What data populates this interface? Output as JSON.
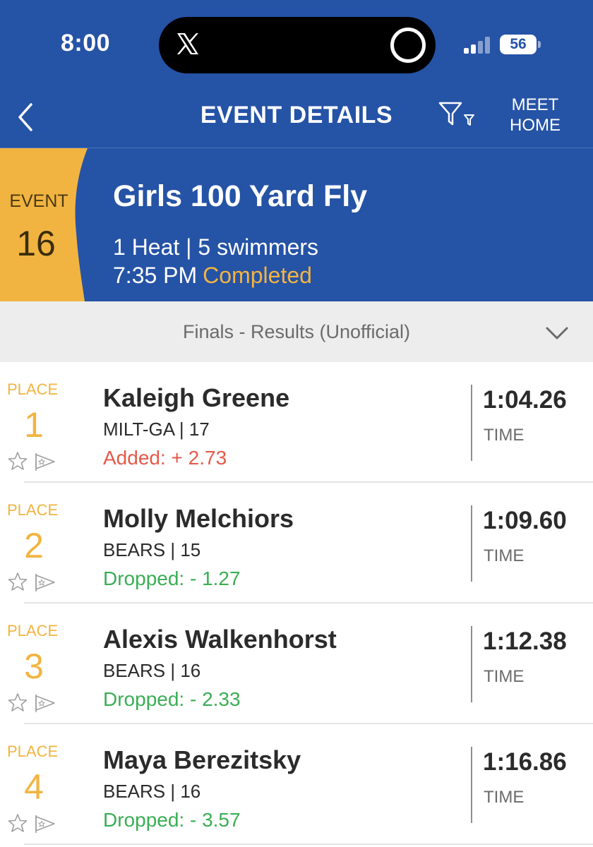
{
  "status_bar": {
    "time": "8:00",
    "battery": "56",
    "icons": [
      "x-logo-icon",
      "recording-ring-icon",
      "cellular-signal-icon",
      "battery-icon"
    ]
  },
  "header": {
    "back_icon": "chevron-left-icon",
    "title": "EVENT DETAILS",
    "filter_icon": "filter-icon",
    "meet_home_label": "MEET\nHOME"
  },
  "event": {
    "badge_label": "EVENT",
    "number": "16",
    "title": "Girls 100 Yard Fly",
    "meta": "1 Heat | 5 swimmers",
    "time": "7:35 PM",
    "status": "Completed"
  },
  "results_selector": {
    "label": "Finals - Results (Unofficial)",
    "icon": "chevron-down-icon"
  },
  "results": [
    {
      "place_label": "PLACE",
      "place": "1",
      "name": "Kaleigh Greene",
      "team": "MILT-GA | 17",
      "change": "Added: + 2.73",
      "change_type": "added",
      "time": "1:04.26",
      "time_label": "TIME"
    },
    {
      "place_label": "PLACE",
      "place": "2",
      "name": "Molly Melchiors",
      "team": "BEARS | 15",
      "change": "Dropped: - 1.27",
      "change_type": "dropped",
      "time": "1:09.60",
      "time_label": "TIME"
    },
    {
      "place_label": "PLACE",
      "place": "3",
      "name": "Alexis Walkenhorst",
      "team": "BEARS | 16",
      "change": "Dropped: - 2.33",
      "change_type": "dropped",
      "time": "1:12.38",
      "time_label": "TIME"
    },
    {
      "place_label": "PLACE",
      "place": "4",
      "name": "Maya Berezitsky",
      "team": "BEARS | 16",
      "change": "Dropped: - 3.57",
      "change_type": "dropped",
      "time": "1:16.86",
      "time_label": "TIME"
    }
  ],
  "colors": {
    "brand_blue": "#2553a6",
    "accent_gold": "#f2b441",
    "added_red": "#e5594a",
    "dropped_green": "#3aae54"
  }
}
